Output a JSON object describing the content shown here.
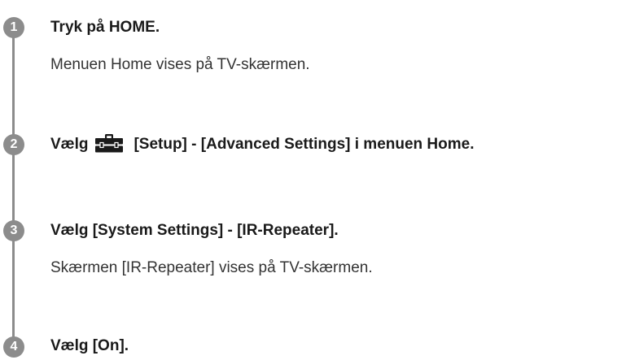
{
  "steps": [
    {
      "number": "1",
      "title": "Tryk på HOME.",
      "description": "Menuen Home vises på TV-skærmen."
    },
    {
      "number": "2",
      "title_prefix": "Vælg",
      "icon": "toolbox-icon",
      "title_suffix": "[Setup] - [Advanced Settings] i menuen Home."
    },
    {
      "number": "3",
      "title": "Vælg [System Settings] - [IR-Repeater].",
      "description": "Skærmen [IR-Repeater] vises på TV-skærmen."
    },
    {
      "number": "4",
      "title": "Vælg [On]."
    }
  ]
}
